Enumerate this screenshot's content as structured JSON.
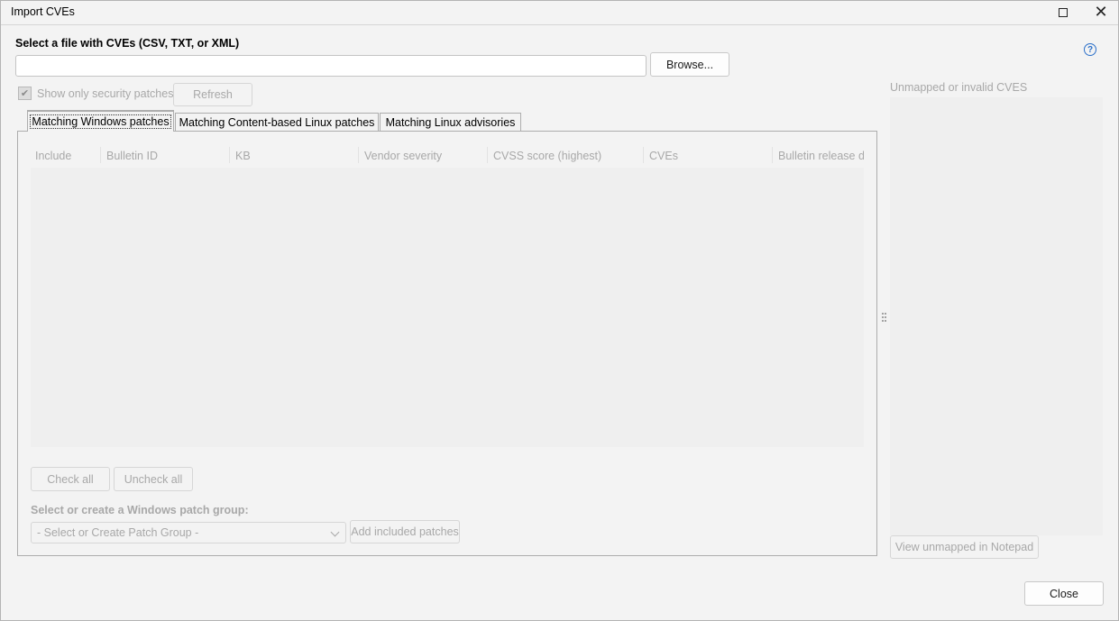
{
  "window": {
    "title": "Import CVEs"
  },
  "file_section": {
    "label": "Select a file with CVEs (CSV, TXT, or XML)",
    "path_value": "",
    "browse_label": "Browse..."
  },
  "filter": {
    "show_security_label": "Show only security patches",
    "show_security_checked": true,
    "refresh_label": "Refresh"
  },
  "tabs": [
    {
      "label": "Matching Windows patches",
      "active": true
    },
    {
      "label": "Matching Content-based Linux patches",
      "active": false
    },
    {
      "label": "Matching Linux advisories",
      "active": false
    }
  ],
  "grid": {
    "columns": [
      "Include",
      "Bulletin ID",
      "KB",
      "Vendor severity",
      "CVSS score (highest)",
      "CVEs",
      "Bulletin release da"
    ],
    "rows": []
  },
  "actions": {
    "check_all": "Check all",
    "uncheck_all": "Uncheck all"
  },
  "patch_group": {
    "label": "Select or create a Windows patch group:",
    "select_value": "- Select or Create Patch Group -",
    "add_label": "Add included patches"
  },
  "unmapped": {
    "label": "Unmapped or invalid CVES",
    "view_label": "View unmapped in Notepad"
  },
  "footer": {
    "close_label": "Close"
  },
  "colors": {
    "accent": "#2a6fc9",
    "disabled_text": "#a8a8a8"
  }
}
